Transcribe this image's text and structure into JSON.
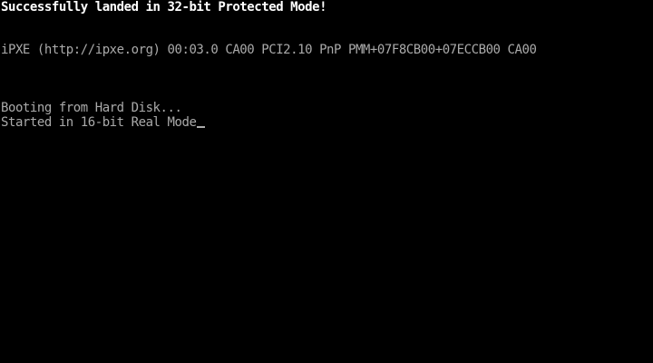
{
  "screen": {
    "lines": {
      "protected_mode": "Successfully landed in 32-bit Protected Mode!",
      "ipxe_banner": "iPXE (http://ipxe.org) 00:03.0 CA00 PCI2.10 PnP PMM+07F8CB00+07ECCB00 CA00",
      "booting": "Booting from Hard Disk...",
      "real_mode": "Started in 16-bit Real Mode"
    },
    "colors": {
      "background": "#000000",
      "bright_text": "#ffffff",
      "normal_text": "#aaaaaa"
    }
  }
}
